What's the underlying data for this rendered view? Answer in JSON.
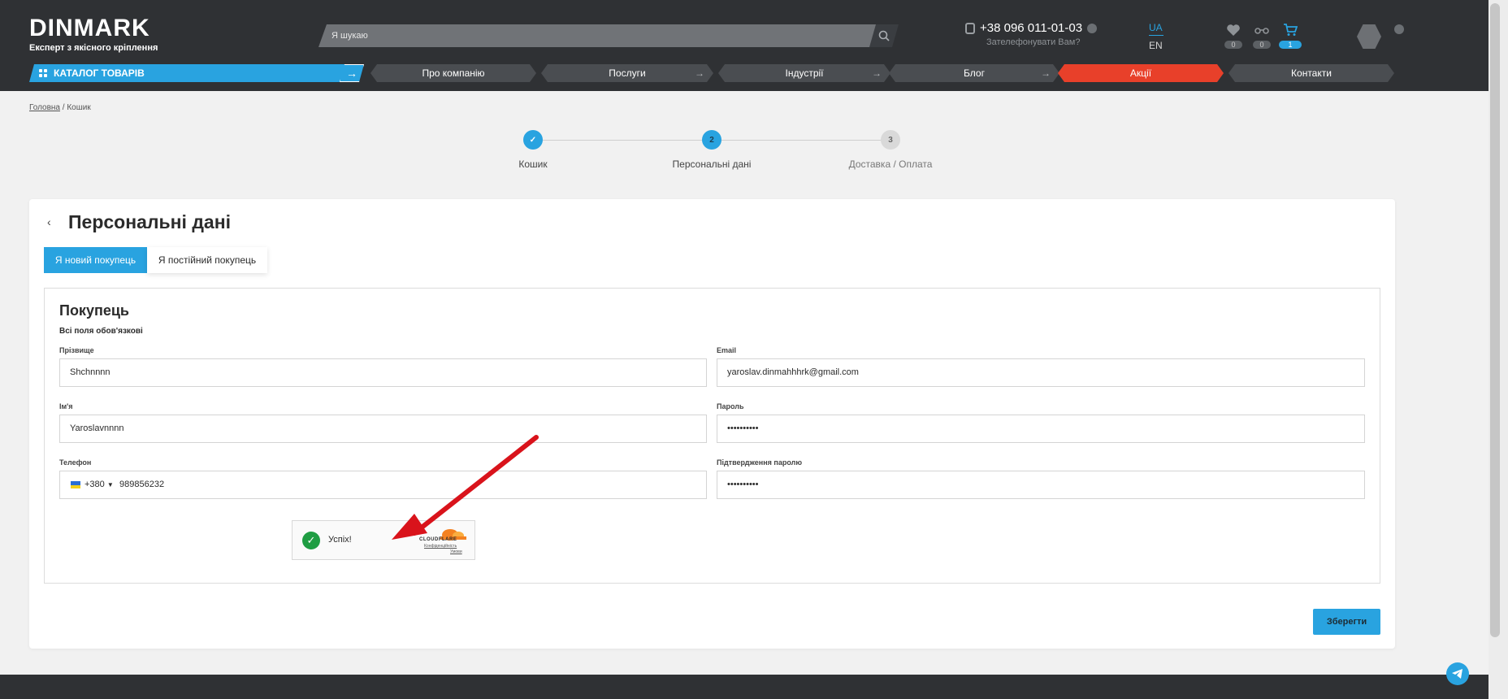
{
  "brand": {
    "logo_text": "DINMARK",
    "tagline": "Експерт з якісного кріплення"
  },
  "header": {
    "search": {
      "placeholder": "Я шукаю"
    },
    "phone": "+38 096 011-01-03",
    "callback": "Зателефонувати Вам?",
    "lang": {
      "active": "UA",
      "other": "EN"
    },
    "badges": {
      "favorites": "0",
      "compare": "0",
      "cart": "1"
    }
  },
  "nav": {
    "catalog": "КАТАЛОГ ТОВАРІВ",
    "items": [
      {
        "label": "Про компанію"
      },
      {
        "label": "Послуги"
      },
      {
        "label": "Індустрії"
      },
      {
        "label": "Блог"
      },
      {
        "label": "Акції"
      },
      {
        "label": "Контакти"
      }
    ]
  },
  "breadcrumb": {
    "home": "Головна",
    "separator": "/",
    "current": "Кошик"
  },
  "steps": [
    {
      "num": "✓",
      "label": "Кошик",
      "state": "done"
    },
    {
      "num": "2",
      "label": "Персональні дані",
      "state": "active"
    },
    {
      "num": "3",
      "label": "Доставка / Оплата",
      "state": "todo"
    }
  ],
  "page": {
    "back_glyph": "‹",
    "title": "Персональні дані",
    "tabs": {
      "new": "Я новий покупець",
      "returning": "Я постійний покупець"
    }
  },
  "form": {
    "title": "Покупець",
    "subtitle": "Всі поля обов'язкові",
    "fields": {
      "last_name": {
        "label": "Прізвище",
        "value": "Shchnnnn"
      },
      "email": {
        "label": "Email",
        "value": "yaroslav.dinmahhhrk@gmail.com"
      },
      "first_name": {
        "label": "Ім'я",
        "value": "Yaroslavnnnn"
      },
      "password": {
        "label": "Пароль",
        "value": "••••••••••"
      },
      "phone": {
        "label": "Телефон",
        "country_code": "+380",
        "value": "989856232"
      },
      "password_confirm": {
        "label": "Підтвердження паролю",
        "value": "••••••••••"
      }
    },
    "save": "Зберегти"
  },
  "captcha": {
    "status": "Успіх!",
    "brand": "CLOUDFLARE",
    "privacy": "Конфіденційність",
    "terms": "Умови"
  },
  "colors": {
    "accent": "#29a3e0",
    "header_bg": "#2f3134",
    "promo": "#e8402a",
    "success": "#1f9d43",
    "annotation_arrow": "#d9131b"
  }
}
